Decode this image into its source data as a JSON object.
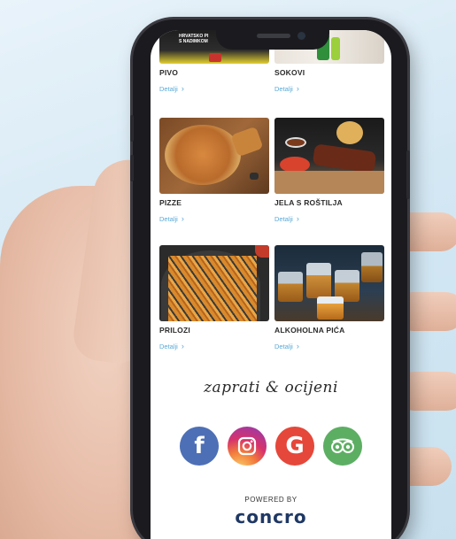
{
  "menu": {
    "items": [
      {
        "title": "PIVO",
        "link": "Detalji",
        "icon": "beer-image"
      },
      {
        "title": "SOKOVI",
        "link": "Detalji",
        "icon": "juice-image"
      },
      {
        "title": "PIZZE",
        "link": "Detalji",
        "icon": "pizza-image"
      },
      {
        "title": "JELA S ROŠTILJA",
        "link": "Detalji",
        "icon": "grill-image"
      },
      {
        "title": "PRILOZI",
        "link": "Detalji",
        "icon": "fries-image"
      },
      {
        "title": "ALKOHOLNA PIĆA",
        "link": "Detalji",
        "icon": "whiskey-image"
      }
    ],
    "beer_banner_text": "HRVATSKO PI\nS NADIMKOM"
  },
  "social": {
    "heading": "zaprati & ocijeni",
    "icons": [
      {
        "name": "facebook-icon",
        "glyph": "f",
        "color": "#4d6fb5"
      },
      {
        "name": "instagram-icon",
        "glyph": "",
        "color": "#d6336c"
      },
      {
        "name": "google-icon",
        "glyph": "G",
        "color": "#e5473a"
      },
      {
        "name": "tripadvisor-icon",
        "glyph": "",
        "color": "#5cae63"
      }
    ]
  },
  "footer": {
    "powered_by": "POWERED BY",
    "brand": "concro"
  },
  "colors": {
    "link": "#5aa9d6",
    "brand": "#1f3864"
  }
}
